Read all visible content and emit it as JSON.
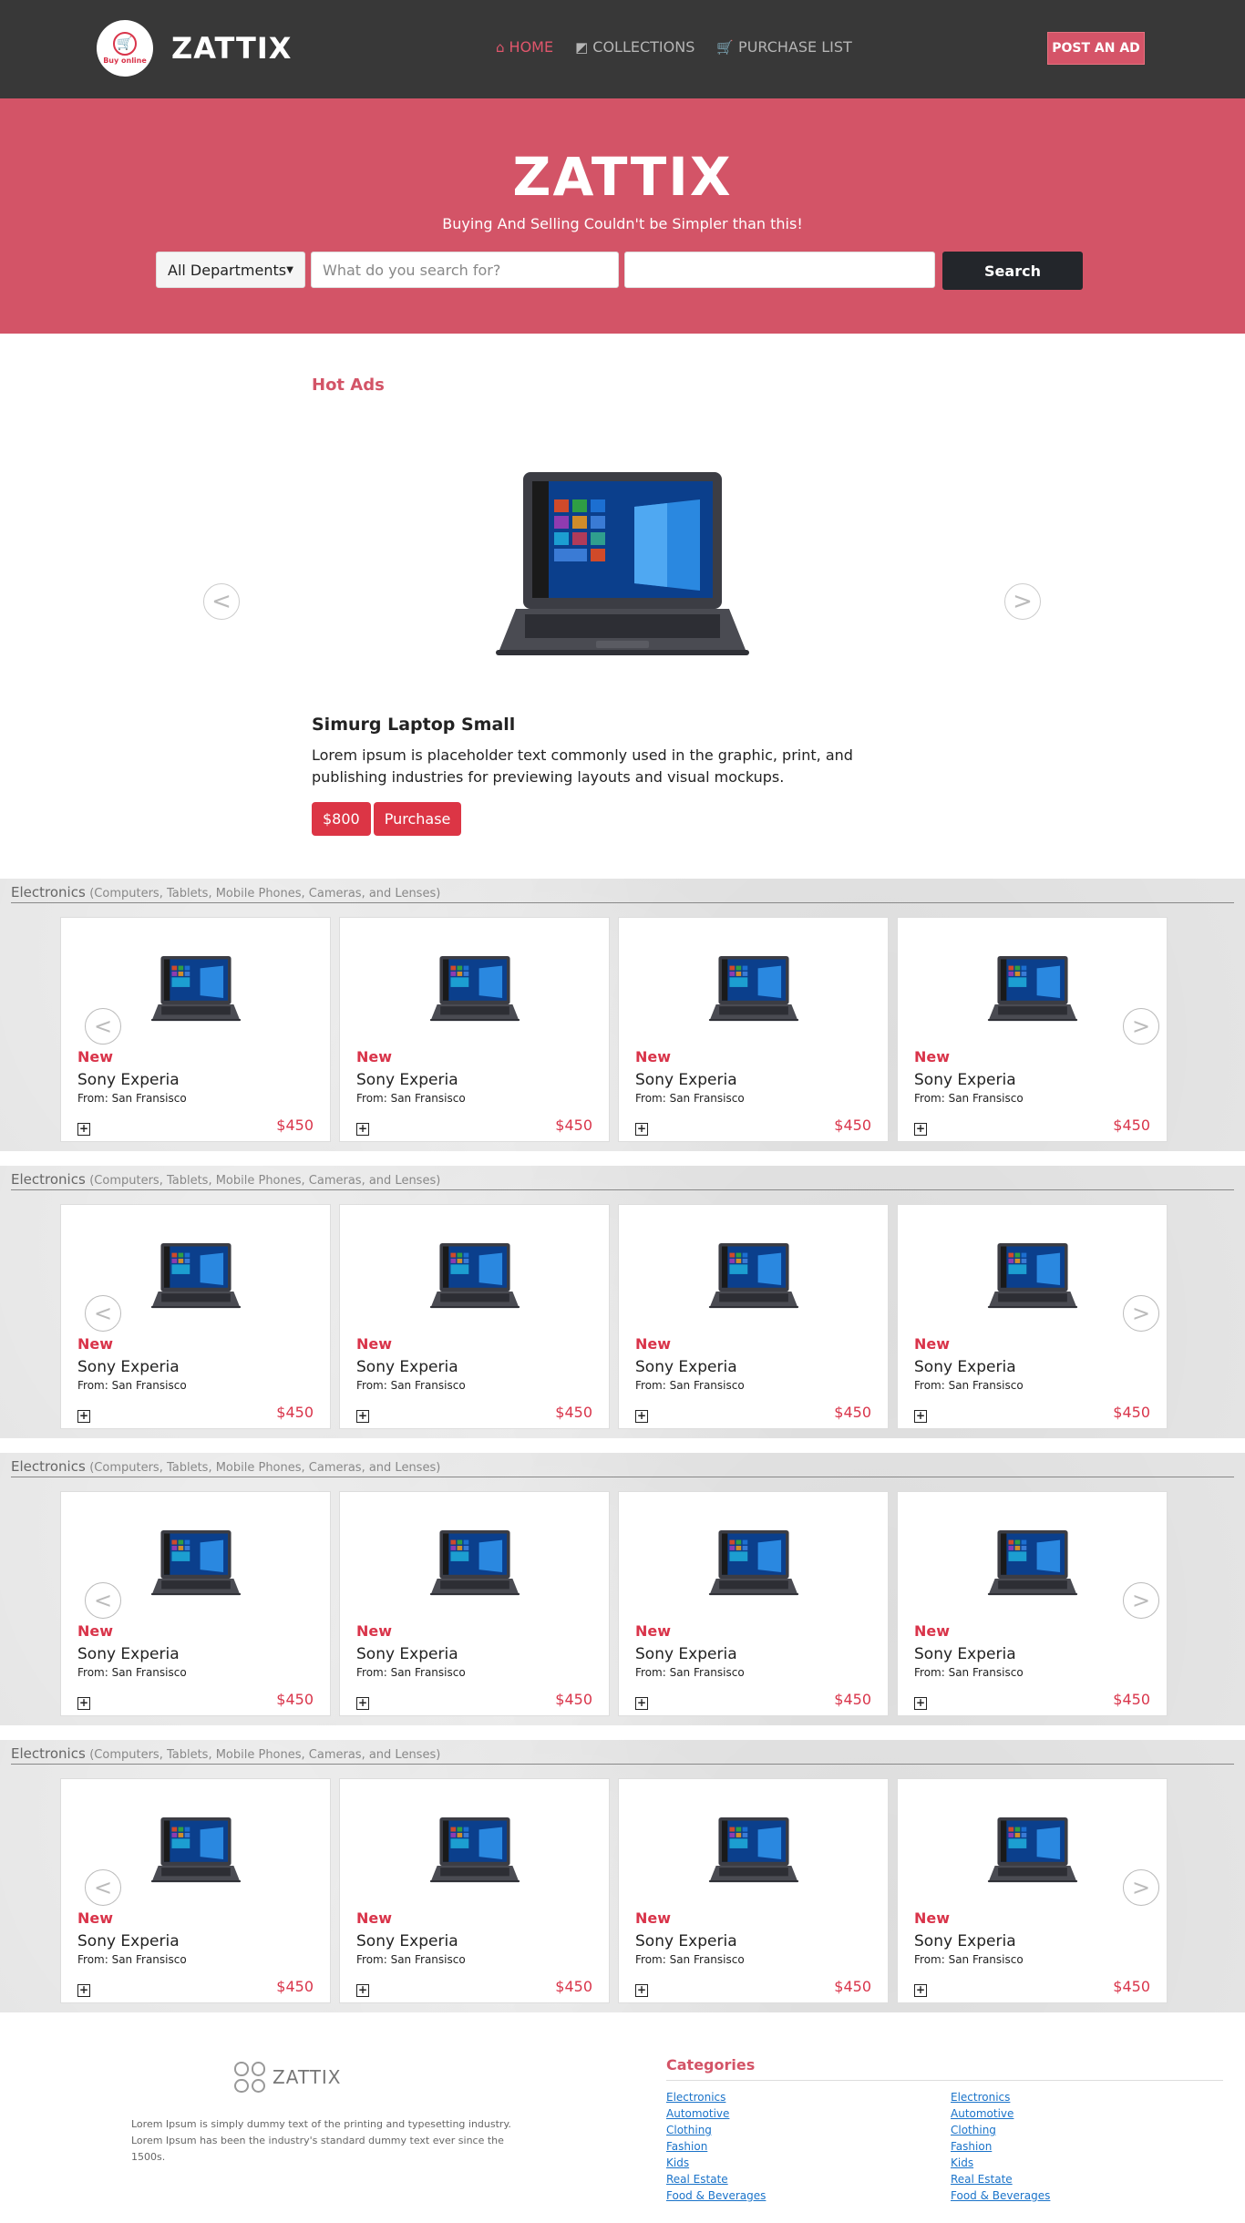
{
  "navbar": {
    "brand": "ZATTIX",
    "logo_text": "Buy online",
    "links": [
      {
        "label": "HOME",
        "icon": "home-icon",
        "active": true
      },
      {
        "label": "COLLECTIONS",
        "icon": "tag-icon",
        "active": false
      },
      {
        "label": "PURCHASE LIST",
        "icon": "cart-icon",
        "active": false
      }
    ],
    "post_ad": "POST AN AD"
  },
  "hero": {
    "title": "ZATTIX",
    "subtitle": "Buying And Selling Couldn't be Simpler than this!",
    "department": "All Departments",
    "search_placeholder": "What do you search for?",
    "search_button": "Search"
  },
  "hot_ads": {
    "title": "Hot Ads",
    "product_name": "Simurg Laptop Small",
    "description": "Lorem ipsum is placeholder text commonly used in the graphic, print, and publishing industries for previewing layouts and visual mockups.",
    "price": "$800",
    "purchase": "Purchase",
    "prev": "<",
    "next": ">"
  },
  "categories": [
    {
      "name": "Electronics",
      "sub": "(Computers, Tablets, Mobile Phones, Cameras, and Lenses)",
      "cards": [
        {
          "badge": "New",
          "title": "Sony Experia",
          "from": "From: San Fransisco",
          "price": "$450"
        },
        {
          "badge": "New",
          "title": "Sony Experia",
          "from": "From: San Fransisco",
          "price": "$450"
        },
        {
          "badge": "New",
          "title": "Sony Experia",
          "from": "From: San Fransisco",
          "price": "$450"
        },
        {
          "badge": "New",
          "title": "Sony Experia",
          "from": "From: San Fransisco",
          "price": "$450"
        }
      ]
    },
    {
      "name": "Electronics",
      "sub": "(Computers, Tablets, Mobile Phones, Cameras, and Lenses)",
      "cards": [
        {
          "badge": "New",
          "title": "Sony Experia",
          "from": "From: San Fransisco",
          "price": "$450"
        },
        {
          "badge": "New",
          "title": "Sony Experia",
          "from": "From: San Fransisco",
          "price": "$450"
        },
        {
          "badge": "New",
          "title": "Sony Experia",
          "from": "From: San Fransisco",
          "price": "$450"
        },
        {
          "badge": "New",
          "title": "Sony Experia",
          "from": "From: San Fransisco",
          "price": "$450"
        }
      ]
    },
    {
      "name": "Electronics",
      "sub": "(Computers, Tablets, Mobile Phones, Cameras, and Lenses)",
      "cards": [
        {
          "badge": "New",
          "title": "Sony Experia",
          "from": "From: San Fransisco",
          "price": "$450"
        },
        {
          "badge": "New",
          "title": "Sony Experia",
          "from": "From: San Fransisco",
          "price": "$450"
        },
        {
          "badge": "New",
          "title": "Sony Experia",
          "from": "From: San Fransisco",
          "price": "$450"
        },
        {
          "badge": "New",
          "title": "Sony Experia",
          "from": "From: San Fransisco",
          "price": "$450"
        }
      ]
    },
    {
      "name": "Electronics",
      "sub": "(Computers, Tablets, Mobile Phones, Cameras, and Lenses)",
      "cards": [
        {
          "badge": "New",
          "title": "Sony Experia",
          "from": "From: San Fransisco",
          "price": "$450"
        },
        {
          "badge": "New",
          "title": "Sony Experia",
          "from": "From: San Fransisco",
          "price": "$450"
        },
        {
          "badge": "New",
          "title": "Sony Experia",
          "from": "From: San Fransisco",
          "price": "$450"
        },
        {
          "badge": "New",
          "title": "Sony Experia",
          "from": "From: San Fransisco",
          "price": "$450"
        }
      ]
    }
  ],
  "footer": {
    "logo": "ZATTIX",
    "text": "Lorem Ipsum is simply dummy text of the printing and typesetting industry. Lorem Ipsum has been the industry's standard dummy text ever since the 1500s.",
    "categories_title": "Categories",
    "col1": [
      "Electronics",
      "Automotive",
      "Clothing",
      "Fashion",
      "Kids",
      "Real Estate",
      "Food & Beverages"
    ],
    "col2": [
      "Electronics",
      "Automotive",
      "Clothing",
      "Fashion",
      "Kids",
      "Real Estate",
      "Food & Beverages"
    ]
  },
  "colors": {
    "accent": "#d35467",
    "nav_bg": "#383838",
    "price": "#d9344a",
    "search_btn": "#23262b"
  }
}
